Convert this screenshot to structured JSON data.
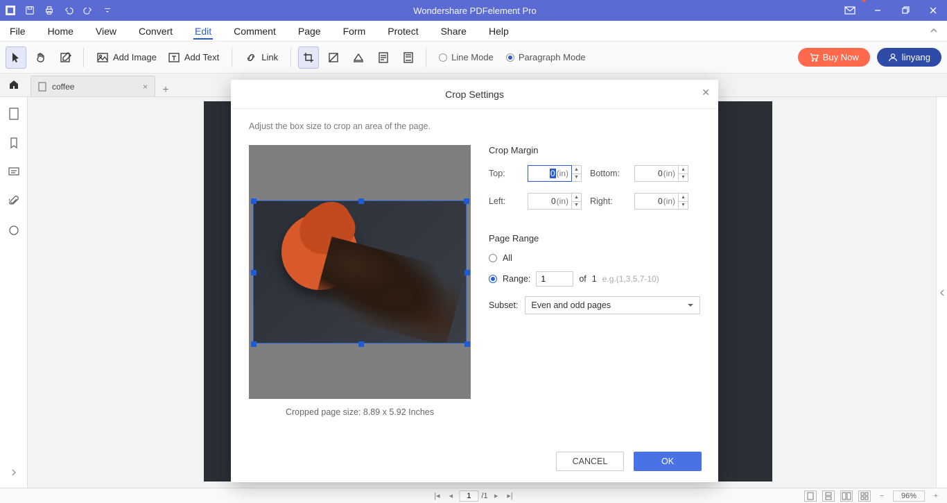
{
  "app": {
    "title": "Wondershare PDFelement Pro"
  },
  "menubar": {
    "items": [
      "File",
      "Home",
      "View",
      "Convert",
      "Edit",
      "Comment",
      "Page",
      "Form",
      "Protect",
      "Share",
      "Help"
    ],
    "active_index": 4
  },
  "ribbon": {
    "add_image": "Add Image",
    "add_text": "Add Text",
    "link": "Link",
    "mode_line": "Line Mode",
    "mode_paragraph": "Paragraph Mode",
    "buy_now": "Buy Now",
    "user_name": "linyang"
  },
  "tabs": {
    "document_name": "coffee"
  },
  "dialog": {
    "title": "Crop Settings",
    "description": "Adjust the box size to crop an area of the page.",
    "section_margin": "Crop Margin",
    "labels": {
      "top": "Top:",
      "bottom": "Bottom:",
      "left": "Left:",
      "right": "Right:"
    },
    "margins": {
      "top": {
        "value": "0",
        "unit": "(in)"
      },
      "bottom": {
        "value": "0",
        "unit": "(in)"
      },
      "left": {
        "value": "0",
        "unit": "(in)"
      },
      "right": {
        "value": "0",
        "unit": "(in)"
      }
    },
    "section_range": "Page Range",
    "range_all": "All",
    "range_range": "Range:",
    "range_value": "1",
    "range_of": "of",
    "range_total": "1",
    "range_hint": "e.g.(1,3,5,7-10)",
    "subset_label": "Subset:",
    "subset_value": "Even and odd pages",
    "crop_info": "Cropped page size: 8.89 x 5.92 Inches",
    "btn_cancel": "CANCEL",
    "btn_ok": "OK"
  },
  "statusbar": {
    "page_current": "1",
    "page_total": "/1",
    "zoom": "96%"
  }
}
